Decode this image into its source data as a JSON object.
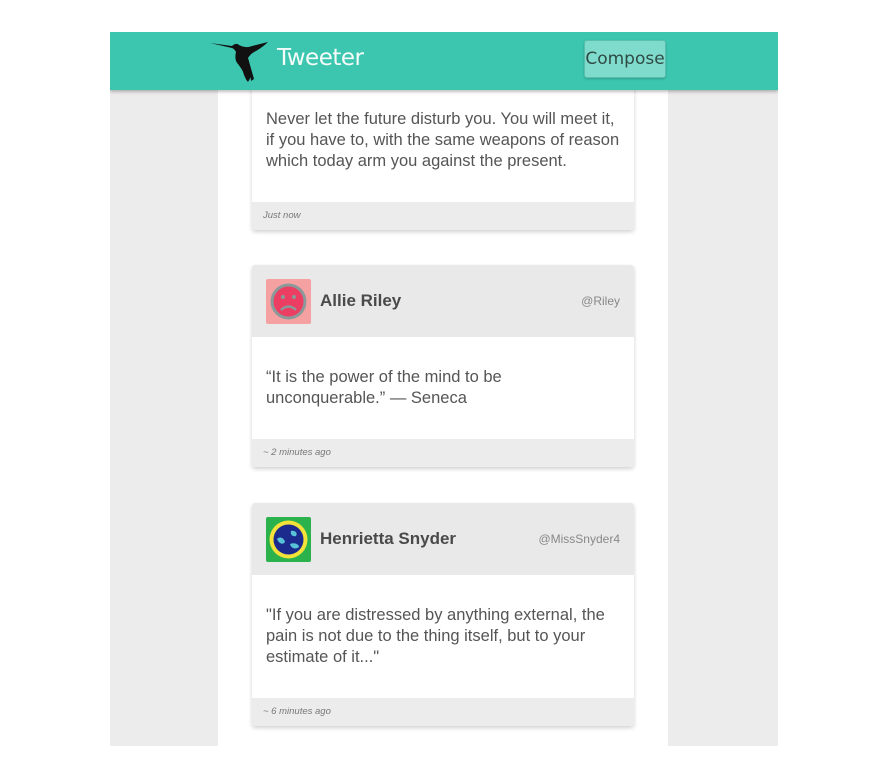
{
  "app": {
    "title": "Tweeter"
  },
  "navbar": {
    "compose_label": "Compose"
  },
  "colors": {
    "accent": "#3cc6b0",
    "compose_button": "#7fdccc",
    "card_header": "#e9e9e9",
    "page_bg": "#ececec"
  },
  "tweets": [
    {
      "text": "Never let the future disturb you. You will meet it, if you have to, with the same weapons of reason which today arm you against the present.",
      "time": "Just now"
    },
    {
      "name": "Allie Riley",
      "handle": "@Riley",
      "avatar": "sad-face-avatar",
      "text": "“It is the power of the mind to be unconquerable.” — Seneca",
      "time": "~ 2 minutes ago"
    },
    {
      "name": "Henrietta Snyder",
      "handle": "@MissSnyder4",
      "avatar": "globe-avatar",
      "text": "\"If you are distressed by anything external, the pain is not due to the thing itself, but to your estimate of it...\"",
      "time": "~ 6 minutes ago"
    }
  ]
}
